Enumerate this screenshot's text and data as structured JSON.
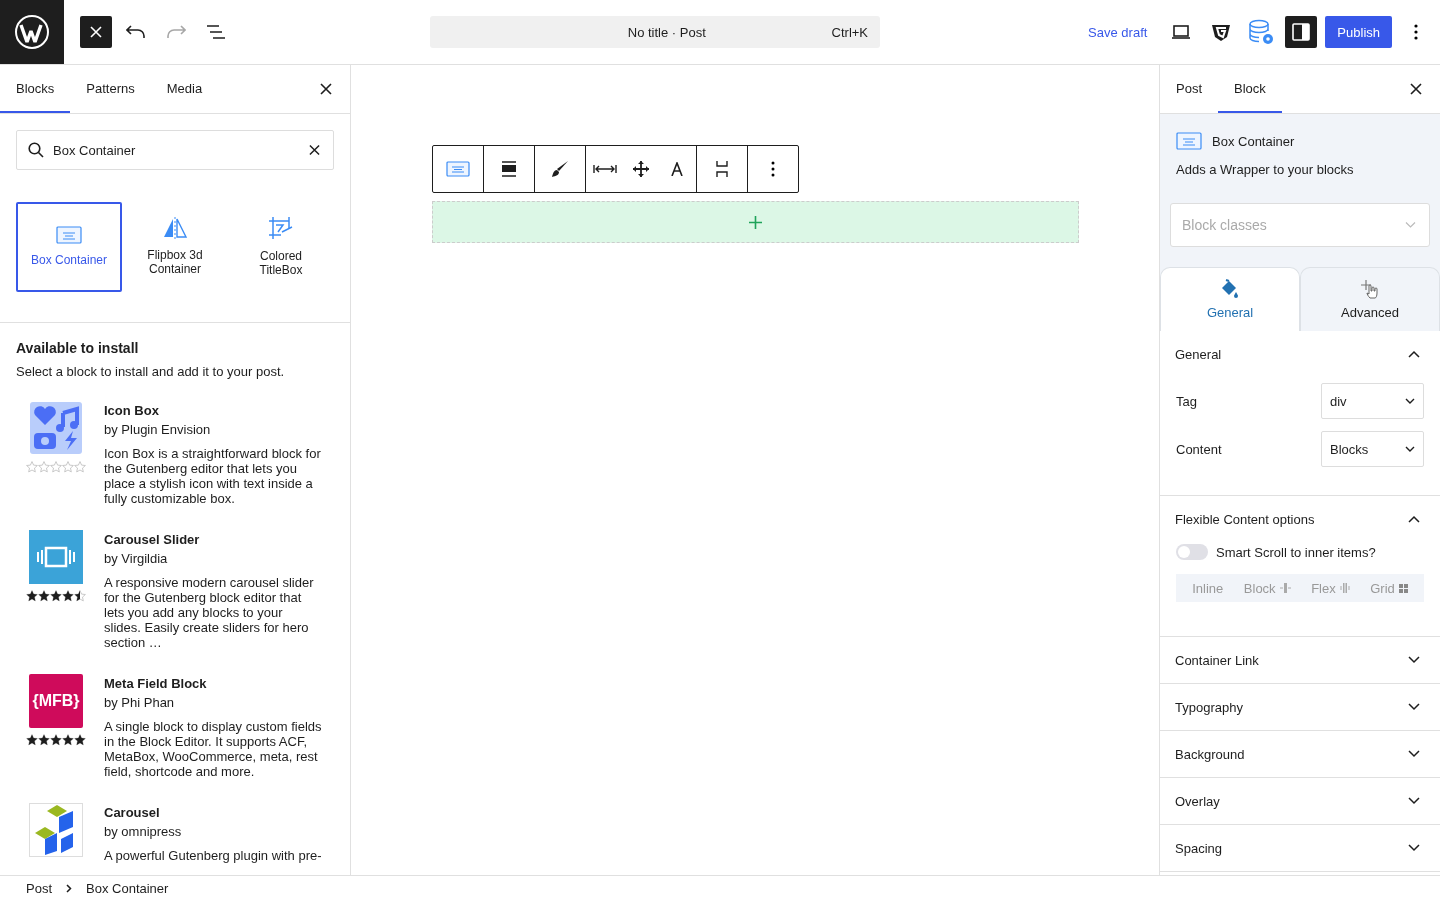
{
  "top_bar": {
    "redo_disabled": true,
    "command": {
      "title": "No title · Post",
      "shortcut": "Ctrl+K"
    },
    "save_draft": "Save draft",
    "publish": "Publish"
  },
  "inserter": {
    "tabs": [
      {
        "label": "Blocks",
        "selected": true
      },
      {
        "label": "Patterns",
        "selected": false
      },
      {
        "label": "Media",
        "selected": false
      }
    ],
    "search": {
      "value": "Box Container"
    },
    "results": [
      {
        "label": "Box Container",
        "selected": true,
        "kind": "box"
      },
      {
        "label": "Flipbox 3d Container",
        "selected": false,
        "kind": "flip"
      },
      {
        "label": "Colored TitleBox",
        "selected": false,
        "kind": "title"
      }
    ],
    "install": {
      "title": "Available to install",
      "subtitle": "Select a block to install and add it to your post.",
      "plugins": [
        {
          "name": "Icon Box",
          "author": "by Plugin Envision",
          "description": "Icon Box is a straightforward block for the Gutenberg editor that lets you place a stylish icon with text inside a fully customizable box.",
          "stars": 0,
          "kind": "icons"
        },
        {
          "name": "Carousel Slider",
          "author": "by Virgildia",
          "description": "A responsive modern carousel slider for the Gutenberg block editor that lets you add any blocks to your slides. Easily create sliders for hero section …",
          "stars": 4.5,
          "kind": "slider"
        },
        {
          "name": "Meta Field Block",
          "author": "by Phi Phan",
          "description": "A single block to display custom fields in the Block Editor. It supports ACF, MetaBox, WooCommerce, meta, rest field, shortcode and more.",
          "stars": 5,
          "kind": "letters",
          "icon_label": "{MFB}"
        },
        {
          "name": "Carousel",
          "author": "by omnipress",
          "description": "A powerful Gutenberg plugin with pre-",
          "kind": "cubes"
        }
      ]
    }
  },
  "sidebar": {
    "tabs": [
      {
        "label": "Post",
        "selected": false
      },
      {
        "label": "Block",
        "selected": true
      }
    ],
    "block": {
      "name": "Box Container",
      "description": "Adds a Wrapper to your blocks"
    },
    "classes": {
      "placeholder": "Block classes"
    },
    "style_tabs": [
      {
        "label": "General",
        "selected": true,
        "kind": "paint"
      },
      {
        "label": "Advanced",
        "selected": false,
        "kind": "move"
      }
    ],
    "general": {
      "title": "General",
      "expanded": true,
      "fields": [
        {
          "label": "Tag",
          "value": "div"
        },
        {
          "label": "Content",
          "value": "Blocks"
        }
      ]
    },
    "flexible": {
      "title": "Flexible Content options",
      "expanded": true,
      "toggle": {
        "label": "Smart Scroll to inner items?",
        "on": false
      },
      "layouts": [
        {
          "label": "Inline",
          "kind": "inline"
        },
        {
          "label": "Block",
          "kind": "block"
        },
        {
          "label": "Flex",
          "kind": "flex"
        },
        {
          "label": "Grid",
          "kind": "grid"
        }
      ]
    },
    "collapsed": [
      {
        "title": "Container Link",
        "expanded": false
      },
      {
        "title": "Typography",
        "expanded": false
      },
      {
        "title": "Background",
        "expanded": false
      },
      {
        "title": "Overlay",
        "expanded": false
      },
      {
        "title": "Spacing",
        "expanded": false
      }
    ]
  },
  "breadcrumb": [
    "Post",
    "Box Container"
  ]
}
